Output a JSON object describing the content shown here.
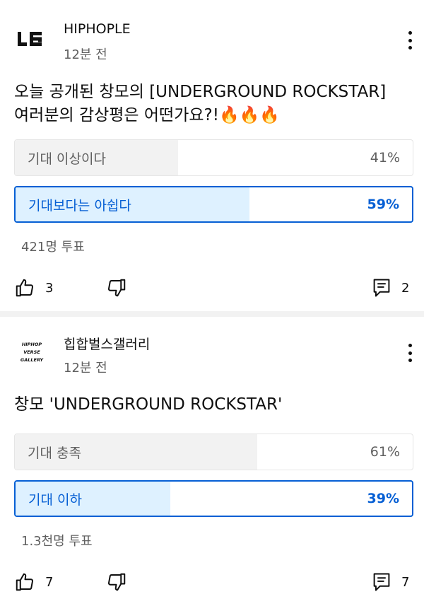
{
  "posts": [
    {
      "channel": "HIPHOPLE",
      "avatar_text": "LE",
      "time": "12분 전",
      "text": "오늘 공개된 창모의 [UNDERGROUND ROCKSTAR]\n여러분의 감상평은 어떤가요?!🔥🔥🔥",
      "poll": [
        {
          "label": "기대 이상이다",
          "percent": "41%",
          "fraction": 0.41,
          "voted": false
        },
        {
          "label": "기대보다는 아쉽다",
          "percent": "59%",
          "fraction": 0.59,
          "voted": true
        }
      ],
      "votes": "421명 투표",
      "likes": "3",
      "comments": "2"
    },
    {
      "channel": "힙합벌스갤러리",
      "avatar_text": "HIPHOP\nVERSE\nGALLERY",
      "time": "12분 전",
      "text": "창모 'UNDERGROUND ROCKSTAR'",
      "poll": [
        {
          "label": "기대 충족",
          "percent": "61%",
          "fraction": 0.61,
          "voted": false
        },
        {
          "label": "기대 이하",
          "percent": "39%",
          "fraction": 0.39,
          "voted": true
        }
      ],
      "votes": "1.3천명 투표",
      "likes": "7",
      "comments": "7"
    }
  ],
  "icons": {
    "like": "thumb-up-icon",
    "dislike": "thumb-down-icon",
    "comment": "comment-icon",
    "more": "more-vert-icon"
  },
  "colors": {
    "accent": "#065fd4",
    "voted_fill": "#def1ff",
    "bar_fill": "#f2f2f2",
    "secondary_text": "#606060"
  }
}
